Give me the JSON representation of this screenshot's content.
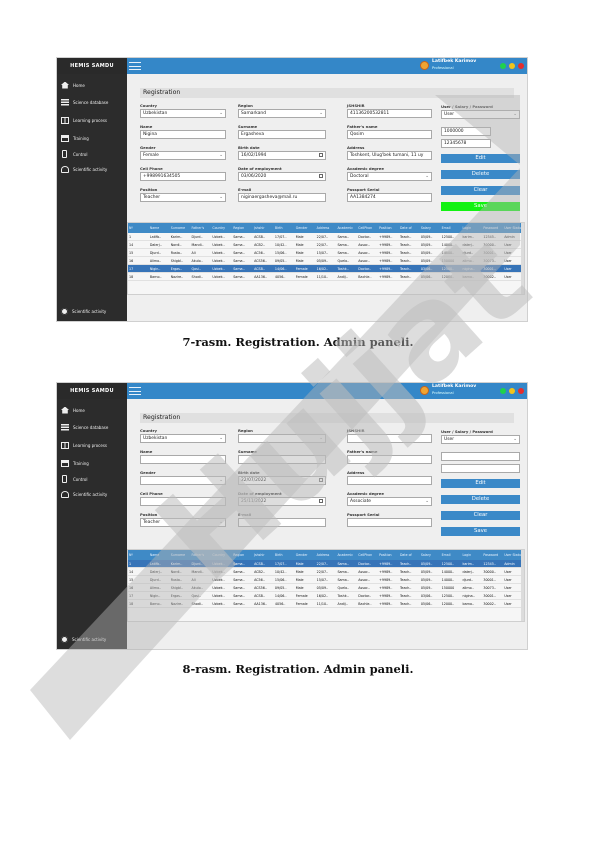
{
  "app": {
    "brand": "HEMIS SAMDU",
    "user_name": "Latifbek Karimov",
    "user_role": "Professional"
  },
  "nav": [
    {
      "label": "Home",
      "icon": "home-icon"
    },
    {
      "label": "Science database",
      "icon": "database-icon"
    },
    {
      "label": "Learning process",
      "icon": "book-icon"
    },
    {
      "label": "Training",
      "icon": "training-icon"
    },
    {
      "label": "Control",
      "icon": "phone-icon"
    },
    {
      "label": "Scientific activity",
      "icon": "person-icon"
    }
  ],
  "nav_bottom": {
    "label": "Scientific activity",
    "icon": "gear-icon"
  },
  "page_title": "Registration",
  "labels": {
    "country": "Country",
    "region": "Region",
    "district": "JSHSHIR",
    "user_salary": "User / Salary / Password",
    "name": "Name",
    "surname": "Surname",
    "father": "Father's name",
    "gender": "Gender",
    "birth": "Birth date",
    "address": "Address",
    "phone": "Cell Phone",
    "employment": "Date of employment",
    "degree": "Academic degree",
    "position": "Position",
    "email": "E-mail",
    "passport": "Passport Serial"
  },
  "buttons": {
    "edit": "Edit",
    "delete": "Delete",
    "clear": "Clear",
    "save": "Save"
  },
  "grid_headers": [
    "Nº",
    "Name",
    "Surname",
    "Father's",
    "Country",
    "Region",
    "Jshshir",
    "Birth",
    "Gender",
    "Address",
    "Academic",
    "CellPhon",
    "Position",
    "Date of",
    "Salary",
    "Email",
    "Login",
    "Password",
    "User Status"
  ],
  "screen1": {
    "form": {
      "country": "Uzbekistan",
      "region": "Samarkand",
      "district": "41136200532811",
      "user_type": "User",
      "name": "Nigina",
      "surname": "Ergasheva",
      "father": "Qosim",
      "salary": "1000000",
      "password": "12345678",
      "gender": "Female",
      "birth": "16/02/1994",
      "address": "Toshkent, Ulug'bek tumani, 11 uy",
      "phone": "+998991634505",
      "employment": "03/06/2020",
      "degree": "Doctoral",
      "position": "Teacher",
      "email": "niginaergasheva@mail.ru",
      "passport": "AA1384274"
    },
    "rows": [
      [
        "1",
        "Latifb..",
        "Karim..",
        "Djurd..",
        "Uzbek..",
        "Sama..",
        "ACSB..",
        "17/07..",
        "Male",
        "22/07..",
        "Sama..",
        "Doctor..",
        "+9989..",
        "Teach..",
        "05/09..",
        "12500..",
        "karim..",
        "12345..",
        "Admin"
      ],
      [
        "14",
        "Dalerj..",
        "Nordi..",
        "Mandi..",
        "Uzbek..",
        "Sama..",
        "ACB2..",
        "10/42..",
        "Male",
        "22/07..",
        "Sama..",
        "Assoc..",
        "+9989..",
        "Teach..",
        "05/09..",
        "14000..",
        "dalerj..",
        "30000..",
        "User"
      ],
      [
        "15",
        "Djurd..",
        "Rusta..",
        "Ali",
        "Uzbek..",
        "Sama..",
        "AC56..",
        "15/06..",
        "Male",
        "15/07..",
        "Sama..",
        "Assoc..",
        "+9989..",
        "Teach..",
        "05/09..",
        "14000..",
        "djurd..",
        "30001..",
        "User"
      ],
      [
        "16",
        "Alimo..",
        "Shigbl..",
        "Akulo..",
        "Uzbek..",
        "Sama..",
        "ACS56..",
        "09/05..",
        "Male",
        "05/09..",
        "Quelo..",
        "Assoc..",
        "+9989..",
        "Teach..",
        "05/09..",
        "150000",
        "alimo..",
        "30073..",
        "User"
      ],
      [
        "17",
        "Nigin..",
        "Ergas..",
        "Qosi..",
        "Uzbek..",
        "Sama..",
        "ACSB..",
        "14/06..",
        "Female",
        "16/02..",
        "Toshk..",
        "Doctor..",
        "+9989..",
        "Teach..",
        "03/06..",
        "12500..",
        "nigina..",
        "30001..",
        "User"
      ],
      [
        "18",
        "Barno..",
        "Nazire..",
        "Shodi..",
        "Uzbek..",
        "Sama..",
        "AA136..",
        "4056..",
        "Female",
        "11/10..",
        "Andij..",
        "Bachle..",
        "+9989..",
        "Teach..",
        "05/06..",
        "12000..",
        "barno..",
        "30002..",
        "User"
      ]
    ],
    "selected_row": 4
  },
  "screen2": {
    "form": {
      "country": "Uzbekistan",
      "region": "",
      "district": "",
      "user_type": "User",
      "name": "",
      "surname": "",
      "father": "",
      "salary": "",
      "password": "",
      "gender": "",
      "birth": "22/07/2022",
      "address": "",
      "phone": "",
      "employment": "25/11/2022",
      "degree": "Associate",
      "position": "Teacher",
      "email": "",
      "passport": ""
    },
    "rows": [
      [
        "1",
        "Latifb..",
        "Karim..",
        "Djurd..",
        "Uzbek..",
        "Sama..",
        "ACSB..",
        "17/07..",
        "Male",
        "22/07..",
        "Sama..",
        "Doctor..",
        "+9989..",
        "Teach..",
        "05/09..",
        "12500..",
        "karim..",
        "12345..",
        "Admin"
      ],
      [
        "14",
        "Dalerj..",
        "Nordi..",
        "Mandi..",
        "Uzbek..",
        "Sama..",
        "ACB2..",
        "10/42..",
        "Male",
        "22/07..",
        "Sama..",
        "Assoc..",
        "+9989..",
        "Teach..",
        "05/09..",
        "14000..",
        "dalerj..",
        "30000..",
        "User"
      ],
      [
        "15",
        "Djurd..",
        "Rusta..",
        "Ali",
        "Uzbek..",
        "Sama..",
        "AC56..",
        "15/06..",
        "Male",
        "15/07..",
        "Sama..",
        "Assoc..",
        "+9989..",
        "Teach..",
        "05/09..",
        "14000..",
        "djurd..",
        "30001..",
        "User"
      ],
      [
        "16",
        "Alimo..",
        "Shigbl..",
        "Akulo..",
        "Uzbek..",
        "Sama..",
        "ACS56..",
        "09/05..",
        "Male",
        "05/09..",
        "Quelo..",
        "Assoc..",
        "+9989..",
        "Teach..",
        "05/09..",
        "150000",
        "alimo..",
        "30073..",
        "User"
      ],
      [
        "17",
        "Nigin..",
        "Ergas..",
        "Qosi..",
        "Uzbek..",
        "Sama..",
        "ACSB..",
        "14/06..",
        "Female",
        "16/02..",
        "Toshk..",
        "Doctor..",
        "+9989..",
        "Teach..",
        "03/06..",
        "12500..",
        "nigina..",
        "30001..",
        "User"
      ],
      [
        "18",
        "Barno..",
        "Nazire..",
        "Shodi..",
        "Uzbek..",
        "Sama..",
        "AA136..",
        "4056..",
        "Female",
        "11/10..",
        "Andij..",
        "Bachle..",
        "+9989..",
        "Teach..",
        "05/06..",
        "12000..",
        "barno..",
        "30002..",
        "User"
      ]
    ],
    "selected_row": 0
  },
  "captions": {
    "fig7": "7-rasm. Registration. Admin paneli.",
    "fig8": "8-rasm. Registration. Admin paneli."
  },
  "colors": {
    "topbar": "#3487c8",
    "sidebar": "#2c2c2c",
    "button": "#3b89c8",
    "save_active": "#12f212",
    "selected_row": "#3774b8",
    "watermark": "#cfcfcf"
  }
}
